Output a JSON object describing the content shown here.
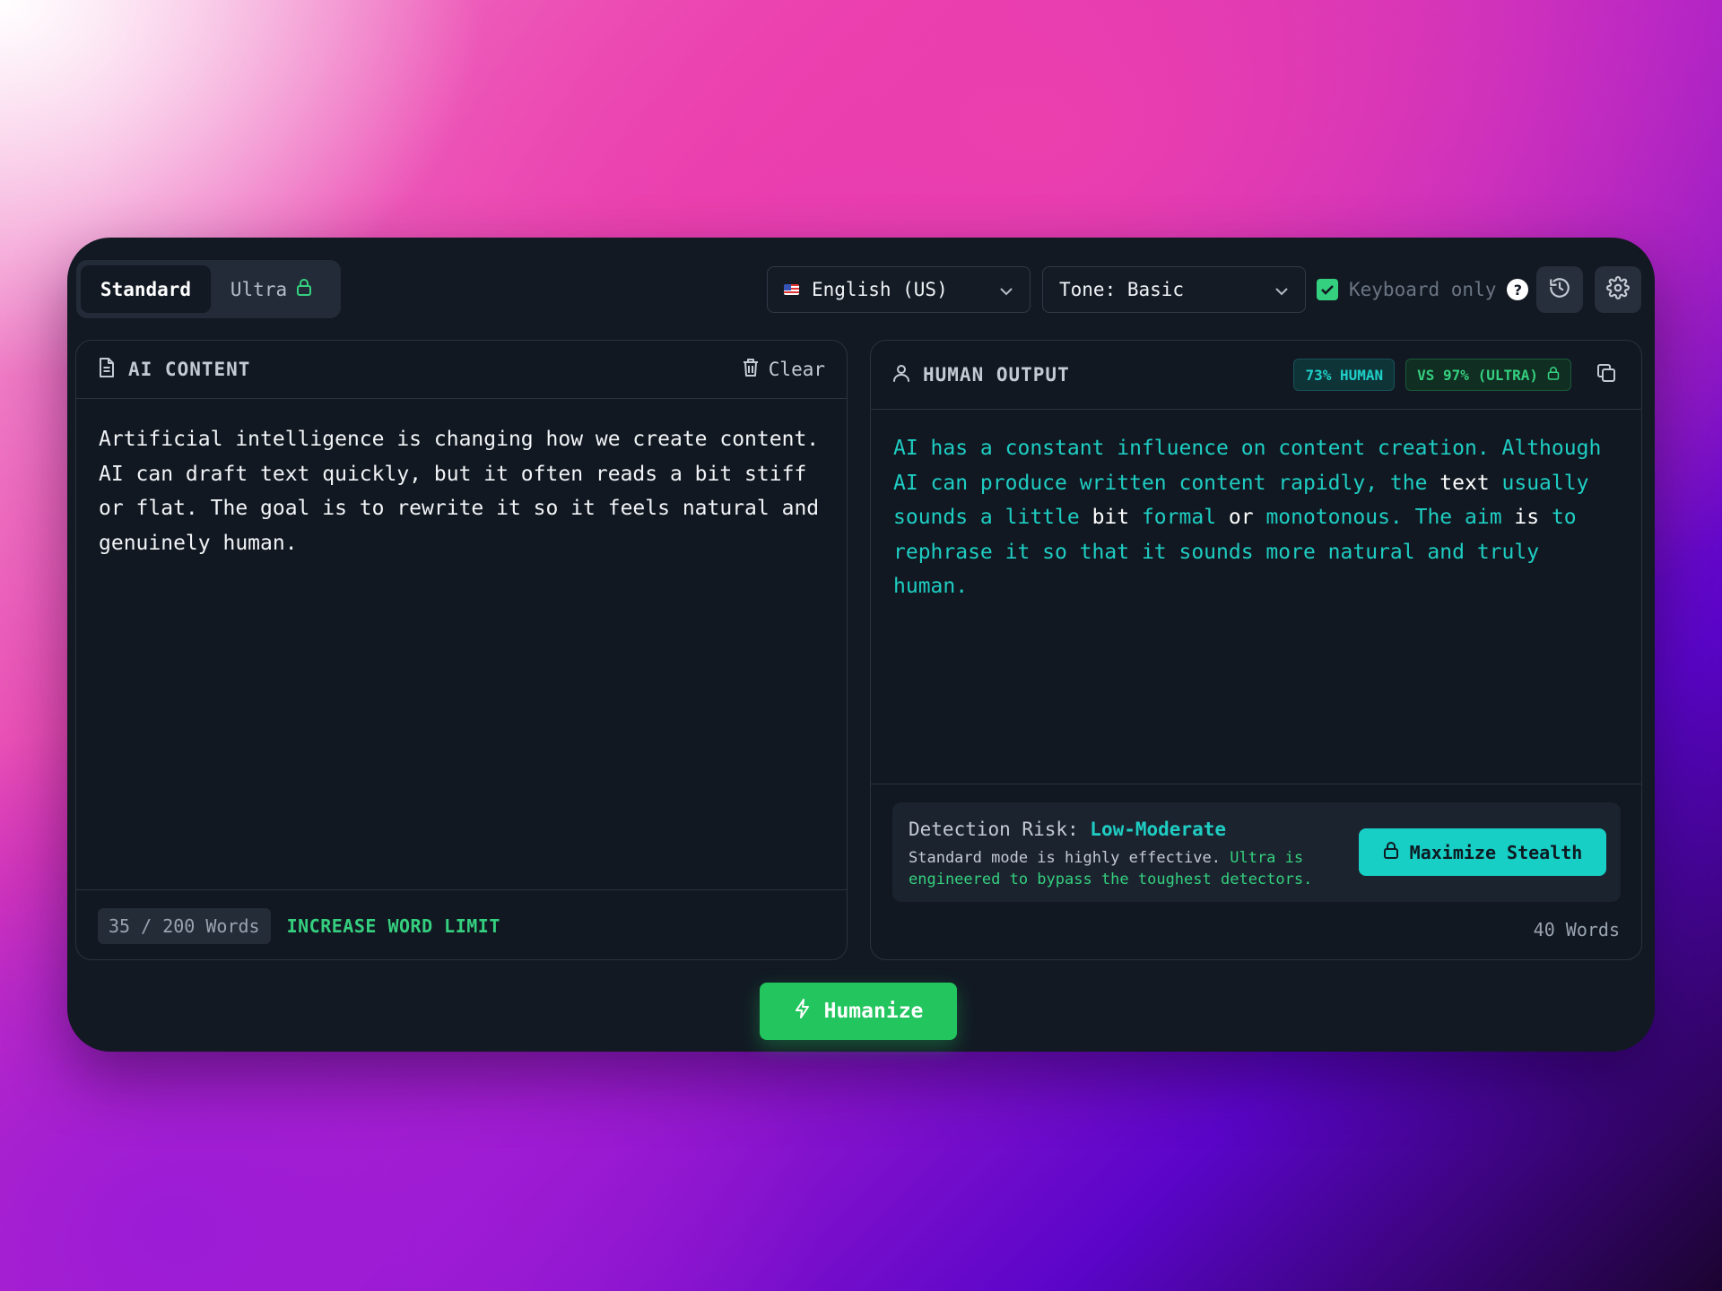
{
  "toolbar": {
    "modes": {
      "standard": "Standard",
      "ultra": "Ultra"
    },
    "language": "English (US)",
    "tone": "Tone: Basic",
    "keyboard_only": {
      "label": "Keyboard only",
      "checked": true,
      "help": "?"
    }
  },
  "input_panel": {
    "title": "AI CONTENT",
    "clear_label": "Clear",
    "text": "Artificial intelligence is changing how we create content. AI can draft text quickly, but it often reads a bit stiff or flat. The goal is to rewrite it so it feels natural and genuinely human.",
    "word_count": "35 / 200 Words",
    "increase_label": "INCREASE WORD LIMIT"
  },
  "output_panel": {
    "title": "HUMAN OUTPUT",
    "human_badge": "73% HUMAN",
    "ultra_badge": "VS 97% (ULTRA)",
    "text_segments": [
      {
        "t": "AI has a constant influence on content creation. Although AI can produce written content rapidly, the ",
        "hl": true
      },
      {
        "t": "text",
        "hl": false
      },
      {
        "t": " usually sounds a little ",
        "hl": true
      },
      {
        "t": "bit",
        "hl": false
      },
      {
        "t": " formal ",
        "hl": true
      },
      {
        "t": "or",
        "hl": false
      },
      {
        "t": " monotonous. The aim ",
        "hl": true
      },
      {
        "t": "is",
        "hl": false
      },
      {
        "t": " to rephrase it so that it sounds more natural and truly human.",
        "hl": true
      }
    ],
    "risk": {
      "label": "Detection Risk: ",
      "level": "Low-Moderate",
      "desc_plain": "Standard mode is highly effective. ",
      "desc_green": "Ultra is engineered to bypass the toughest detectors."
    },
    "stealth_label": "Maximize Stealth",
    "word_count": "40 Words"
  },
  "humanize_label": "Humanize",
  "colors": {
    "accent_green": "#22c55e",
    "accent_teal": "#17cfc5",
    "panel_bg": "#121923"
  }
}
